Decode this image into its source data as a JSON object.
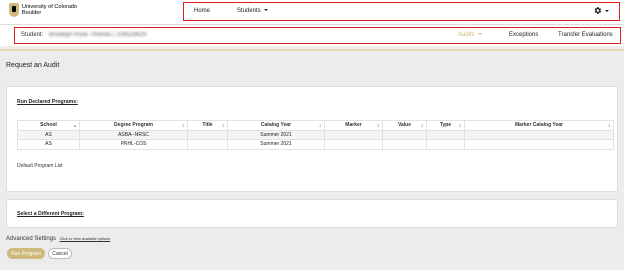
{
  "logo": {
    "line1": "University of Colorado",
    "line2": "Boulder"
  },
  "nav": {
    "home": "Home",
    "students": "Students"
  },
  "student": {
    "label": "Student:",
    "name": "Brooklyn Rose Thomas | 108529429"
  },
  "tabs": [
    {
      "label": "Audits"
    },
    {
      "label": "Exceptions"
    },
    {
      "label": "Transfer Evaluations"
    }
  ],
  "page_title": "Request an Audit",
  "declared": {
    "heading": "Run Declared Programs:",
    "columns": [
      "School",
      "Degree Program",
      "Title",
      "Catalog Year",
      "Marker",
      "Value",
      "Type",
      "Marker Catalog Year"
    ],
    "rows": [
      [
        "AS",
        "ASBA--NRSC",
        "",
        "Summer 2021",
        "",
        "",
        "",
        ""
      ],
      [
        "AS",
        "PRHL-COS",
        "",
        "Summer 2021",
        "",
        "",
        "",
        ""
      ]
    ],
    "default_list": "Default Program List"
  },
  "different": {
    "heading": "Select a Different Program:"
  },
  "advanced": {
    "label": "Advanced Settings",
    "link": "Click to view available options"
  },
  "buttons": {
    "run": "Run Program",
    "cancel": "Cancel"
  },
  "colors": {
    "accent_gold": "#cfb87c",
    "highlight_red": "#e02020"
  }
}
